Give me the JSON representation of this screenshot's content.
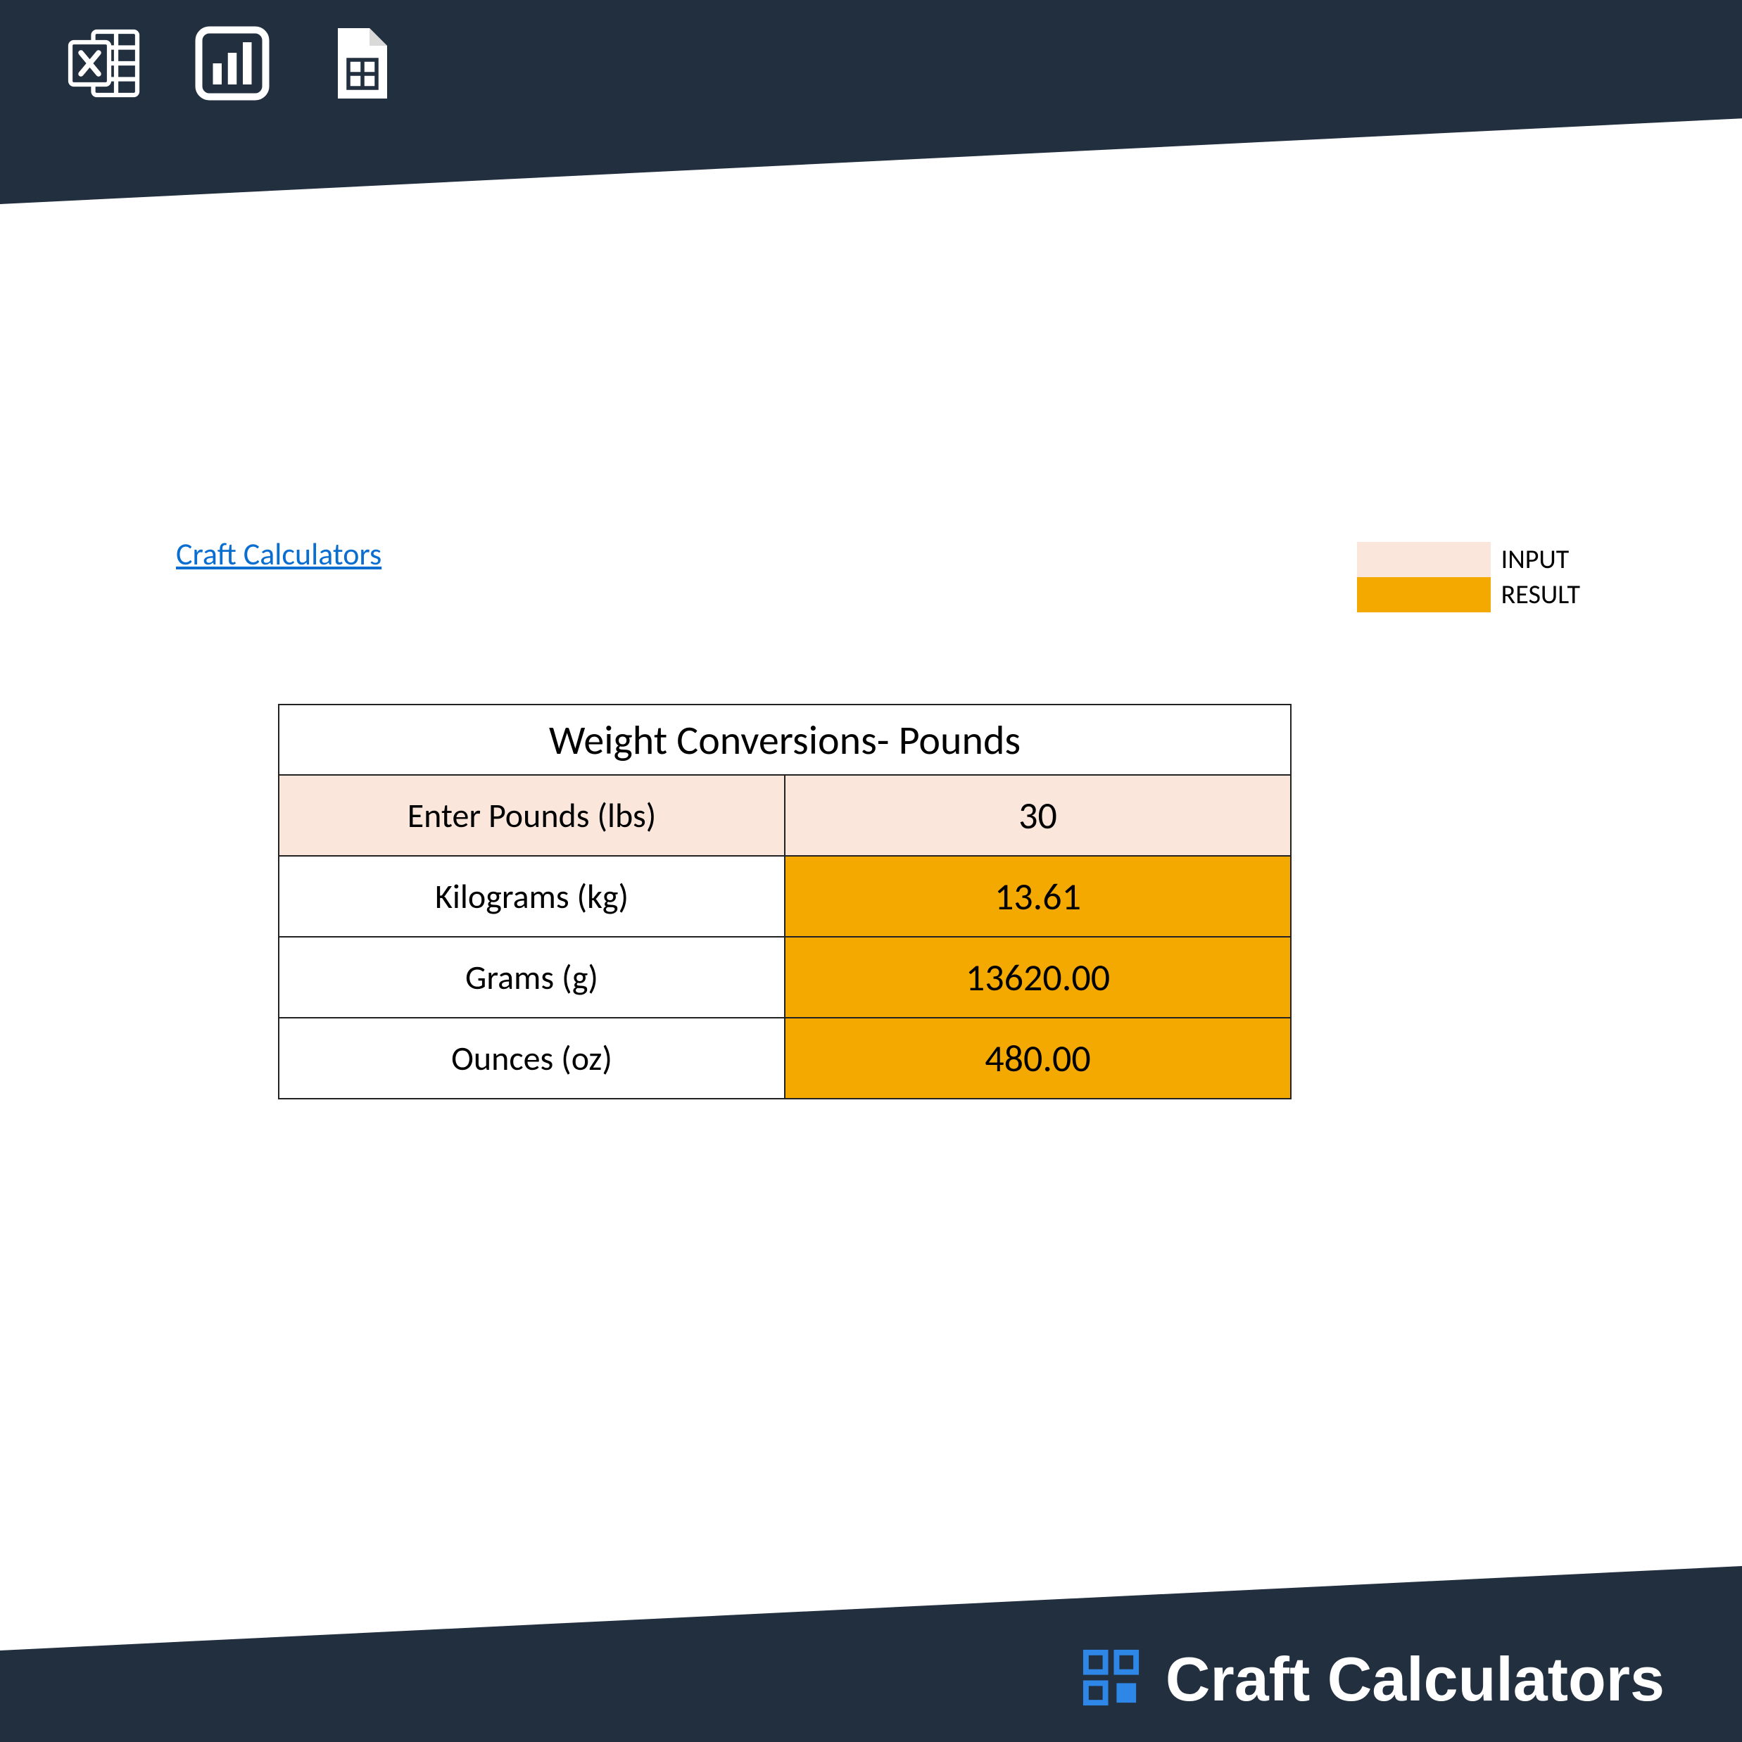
{
  "link_text": "Craft Calculators",
  "legend": {
    "input_label": "INPUT",
    "result_label": "RESULT"
  },
  "colors": {
    "input_bg": "#fae6da",
    "result_bg": "#f3a900",
    "banner_bg": "#222f3f",
    "link_color": "#0a6ed1",
    "brand_accent": "#0a6ed1"
  },
  "table": {
    "title": "Weight Conversions- Pounds",
    "rows": [
      {
        "label": "Enter Pounds (lbs)",
        "value": "30",
        "value_class": "bg-input",
        "label_class": "bg-input"
      },
      {
        "label": "Kilograms (kg)",
        "value": "13.61",
        "value_class": "bg-result",
        "label_class": "bg-white"
      },
      {
        "label": "Grams (g)",
        "value": "13620.00",
        "value_class": "bg-result",
        "label_class": "bg-white"
      },
      {
        "label": "Ounces (oz)",
        "value": "480.00",
        "value_class": "bg-result",
        "label_class": "bg-white"
      }
    ]
  },
  "brand": {
    "name": "Craft Calculators"
  },
  "icons": {
    "top": [
      "excel-icon",
      "dashboard-icon",
      "sheets-icon"
    ]
  }
}
